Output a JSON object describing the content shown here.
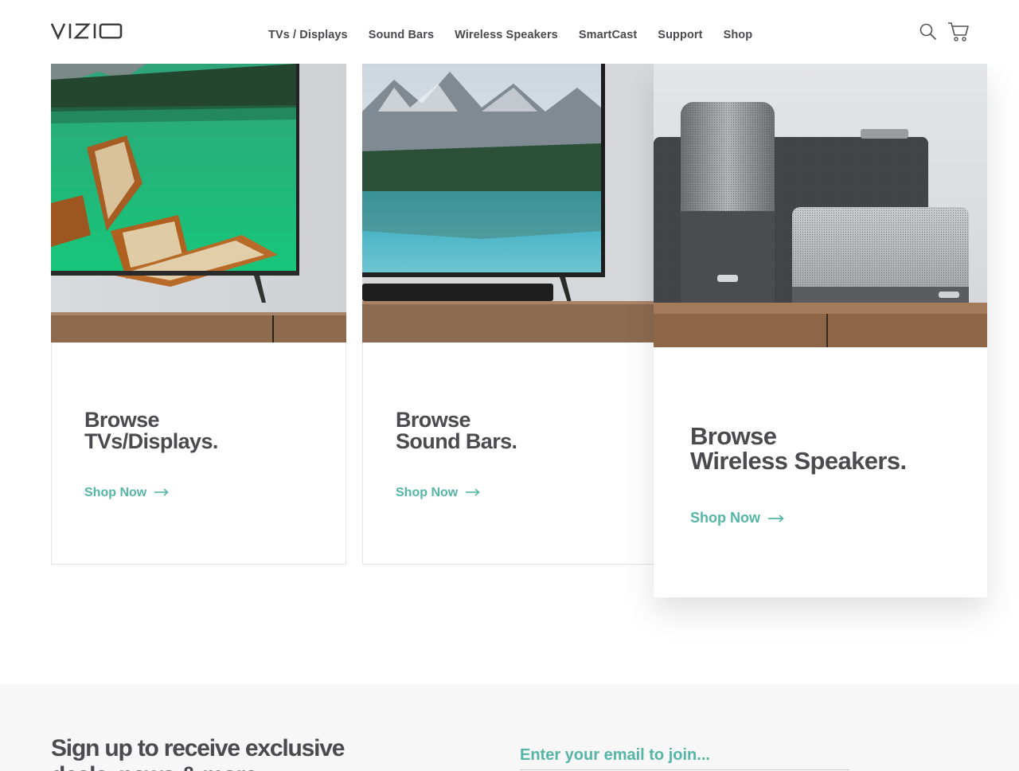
{
  "brand": {
    "logo_text": "VIZIO"
  },
  "nav": {
    "items": [
      {
        "label": "TVs / Displays"
      },
      {
        "label": "Sound Bars"
      },
      {
        "label": "Wireless Speakers"
      },
      {
        "label": "SmartCast"
      },
      {
        "label": "Support"
      },
      {
        "label": "Shop"
      }
    ]
  },
  "header_icons": {
    "search": "search-icon",
    "cart": "cart-icon"
  },
  "cards": [
    {
      "title_line1": "Browse",
      "title_line2": "TVs/Displays.",
      "link": "Shop Now",
      "image": "tv-lake-boats"
    },
    {
      "title_line1": "Browse",
      "title_line2": "Sound Bars.",
      "link": "Shop Now",
      "image": "tv-soundbar-mountain-lake"
    },
    {
      "title_line1": "Browse",
      "title_line2": "Wireless Speakers.",
      "link": "Shop Now",
      "image": "wireless-speakers"
    }
  ],
  "signup": {
    "heading": "Sign up to receive exclusive deals, news & more.",
    "placeholder": "Enter your email to join..."
  },
  "colors": {
    "accent": "#55b5a6",
    "text": "#4a4a4f",
    "band": "#f7f7f7"
  }
}
